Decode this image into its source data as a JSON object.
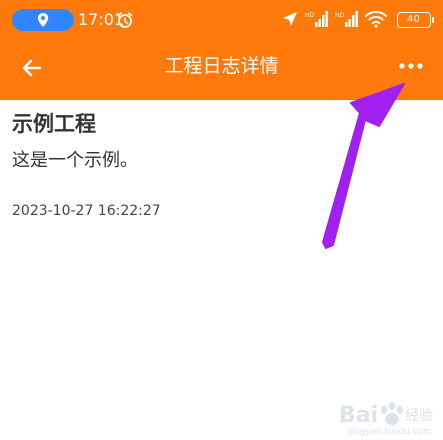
{
  "status_bar": {
    "time": "17:01",
    "battery": "40",
    "colors": {
      "pill": "#2f86ff"
    }
  },
  "app_bar": {
    "title": "工程日志详情",
    "back_icon": "arrow-left-icon",
    "more_icon": "more-horizontal-icon",
    "color": "#ff7a0a"
  },
  "log": {
    "title": "示例工程",
    "body": "这是一个示例。",
    "timestamp": "2023-10-27 16:22:27"
  },
  "annotation": {
    "arrow_color": "#a020f0"
  }
}
